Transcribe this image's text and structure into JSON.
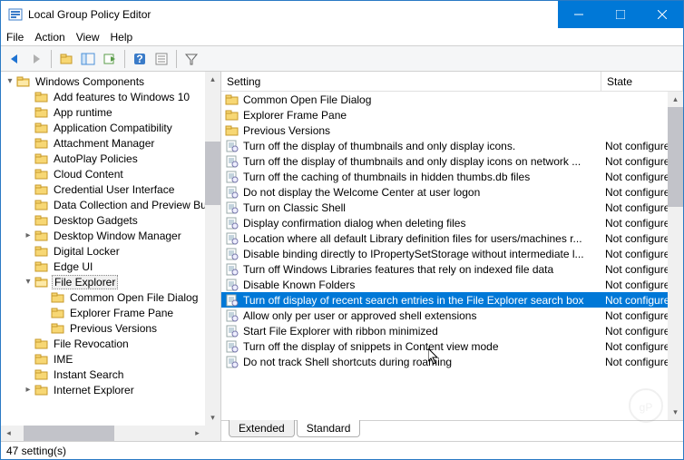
{
  "window": {
    "title": "Local Group Policy Editor"
  },
  "menu": {
    "file": "File",
    "action": "Action",
    "view": "View",
    "help": "Help"
  },
  "tree": {
    "root": "Windows Components",
    "items": [
      {
        "label": "Add features to Windows 10",
        "depth": 1
      },
      {
        "label": "App runtime",
        "depth": 1
      },
      {
        "label": "Application Compatibility",
        "depth": 1
      },
      {
        "label": "Attachment Manager",
        "depth": 1
      },
      {
        "label": "AutoPlay Policies",
        "depth": 1
      },
      {
        "label": "Cloud Content",
        "depth": 1
      },
      {
        "label": "Credential User Interface",
        "depth": 1
      },
      {
        "label": "Data Collection and Preview Bu",
        "depth": 1
      },
      {
        "label": "Desktop Gadgets",
        "depth": 1
      },
      {
        "label": "Desktop Window Manager",
        "depth": 1,
        "caret": ">"
      },
      {
        "label": "Digital Locker",
        "depth": 1
      },
      {
        "label": "Edge UI",
        "depth": 1
      },
      {
        "label": "File Explorer",
        "depth": 1,
        "caret": "v",
        "selected": true
      },
      {
        "label": "Common Open File Dialog",
        "depth": 2
      },
      {
        "label": "Explorer Frame Pane",
        "depth": 2
      },
      {
        "label": "Previous Versions",
        "depth": 2
      },
      {
        "label": "File Revocation",
        "depth": 1
      },
      {
        "label": "IME",
        "depth": 1
      },
      {
        "label": "Instant Search",
        "depth": 1
      },
      {
        "label": "Internet Explorer",
        "depth": 1,
        "caret": ">"
      }
    ]
  },
  "list": {
    "headers": {
      "setting": "Setting",
      "state": "State"
    },
    "rows": [
      {
        "type": "folder",
        "label": "Common Open File Dialog",
        "state": ""
      },
      {
        "type": "folder",
        "label": "Explorer Frame Pane",
        "state": ""
      },
      {
        "type": "folder",
        "label": "Previous Versions",
        "state": ""
      },
      {
        "type": "policy",
        "label": "Turn off the display of thumbnails and only display icons.",
        "state": "Not configured"
      },
      {
        "type": "policy",
        "label": "Turn off the display of thumbnails and only display icons on network ...",
        "state": "Not configured"
      },
      {
        "type": "policy",
        "label": "Turn off the caching of thumbnails in hidden thumbs.db files",
        "state": "Not configured"
      },
      {
        "type": "policy",
        "label": "Do not display the Welcome Center at user logon",
        "state": "Not configured"
      },
      {
        "type": "policy",
        "label": "Turn on Classic Shell",
        "state": "Not configured"
      },
      {
        "type": "policy",
        "label": "Display confirmation dialog when deleting files",
        "state": "Not configured"
      },
      {
        "type": "policy",
        "label": "Location where all default Library definition files for users/machines r...",
        "state": "Not configured"
      },
      {
        "type": "policy",
        "label": "Disable binding directly to IPropertySetStorage without intermediate l...",
        "state": "Not configured"
      },
      {
        "type": "policy",
        "label": "Turn off Windows Libraries features that rely on indexed file data",
        "state": "Not configured"
      },
      {
        "type": "policy",
        "label": "Disable Known Folders",
        "state": "Not configured"
      },
      {
        "type": "policy",
        "label": "Turn off display of recent search entries in the File Explorer search box",
        "state": "Not configured",
        "selected": true
      },
      {
        "type": "policy",
        "label": "Allow only per user or approved shell extensions",
        "state": "Not configured"
      },
      {
        "type": "policy",
        "label": "Start File Explorer with ribbon minimized",
        "state": "Not configured"
      },
      {
        "type": "policy",
        "label": "Turn off the display of snippets in Content view mode",
        "state": "Not configured"
      },
      {
        "type": "policy",
        "label": "Do not track Shell shortcuts during roaming",
        "state": "Not configured"
      }
    ]
  },
  "tabs": {
    "extended": "Extended",
    "standard": "Standard"
  },
  "status": {
    "text": "47 setting(s)"
  }
}
